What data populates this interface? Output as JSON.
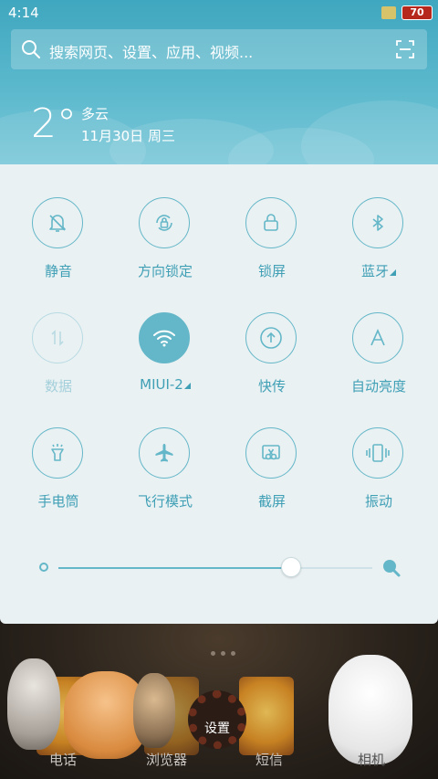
{
  "status_bar": {
    "time": "4:14",
    "battery": "70"
  },
  "search": {
    "placeholder": "搜索网页、设置、应用、视频..."
  },
  "weather": {
    "temperature": "2°",
    "condition": "多云",
    "date": "11月30日 周三"
  },
  "toggles": [
    {
      "label": "静音",
      "icon": "bell-off-icon",
      "state": "off"
    },
    {
      "label": "方向锁定",
      "icon": "rotation-lock-icon",
      "state": "off"
    },
    {
      "label": "锁屏",
      "icon": "lock-icon",
      "state": "off"
    },
    {
      "label": "蓝牙",
      "icon": "bluetooth-icon",
      "state": "off",
      "has_menu": true
    },
    {
      "label": "数据",
      "icon": "data-arrows-icon",
      "state": "disabled"
    },
    {
      "label": "MIUI-2",
      "icon": "wifi-icon",
      "state": "on",
      "has_menu": true
    },
    {
      "label": "快传",
      "icon": "upload-icon",
      "state": "off"
    },
    {
      "label": "自动亮度",
      "icon": "letter-a-icon",
      "state": "off"
    },
    {
      "label": "手电筒",
      "icon": "flashlight-icon",
      "state": "off"
    },
    {
      "label": "飞行模式",
      "icon": "airplane-icon",
      "state": "off"
    },
    {
      "label": "截屏",
      "icon": "scissors-icon",
      "state": "off"
    },
    {
      "label": "振动",
      "icon": "vibrate-icon",
      "state": "off"
    }
  ],
  "brightness": {
    "level": 0.74
  },
  "dock": {
    "labels": [
      "电话",
      "浏览器",
      "短信",
      "相机"
    ],
    "settings_label": "设置"
  },
  "colors": {
    "accent": "#64b7c8",
    "header": "#4fb0c6",
    "panel": "#eaf1f3"
  }
}
